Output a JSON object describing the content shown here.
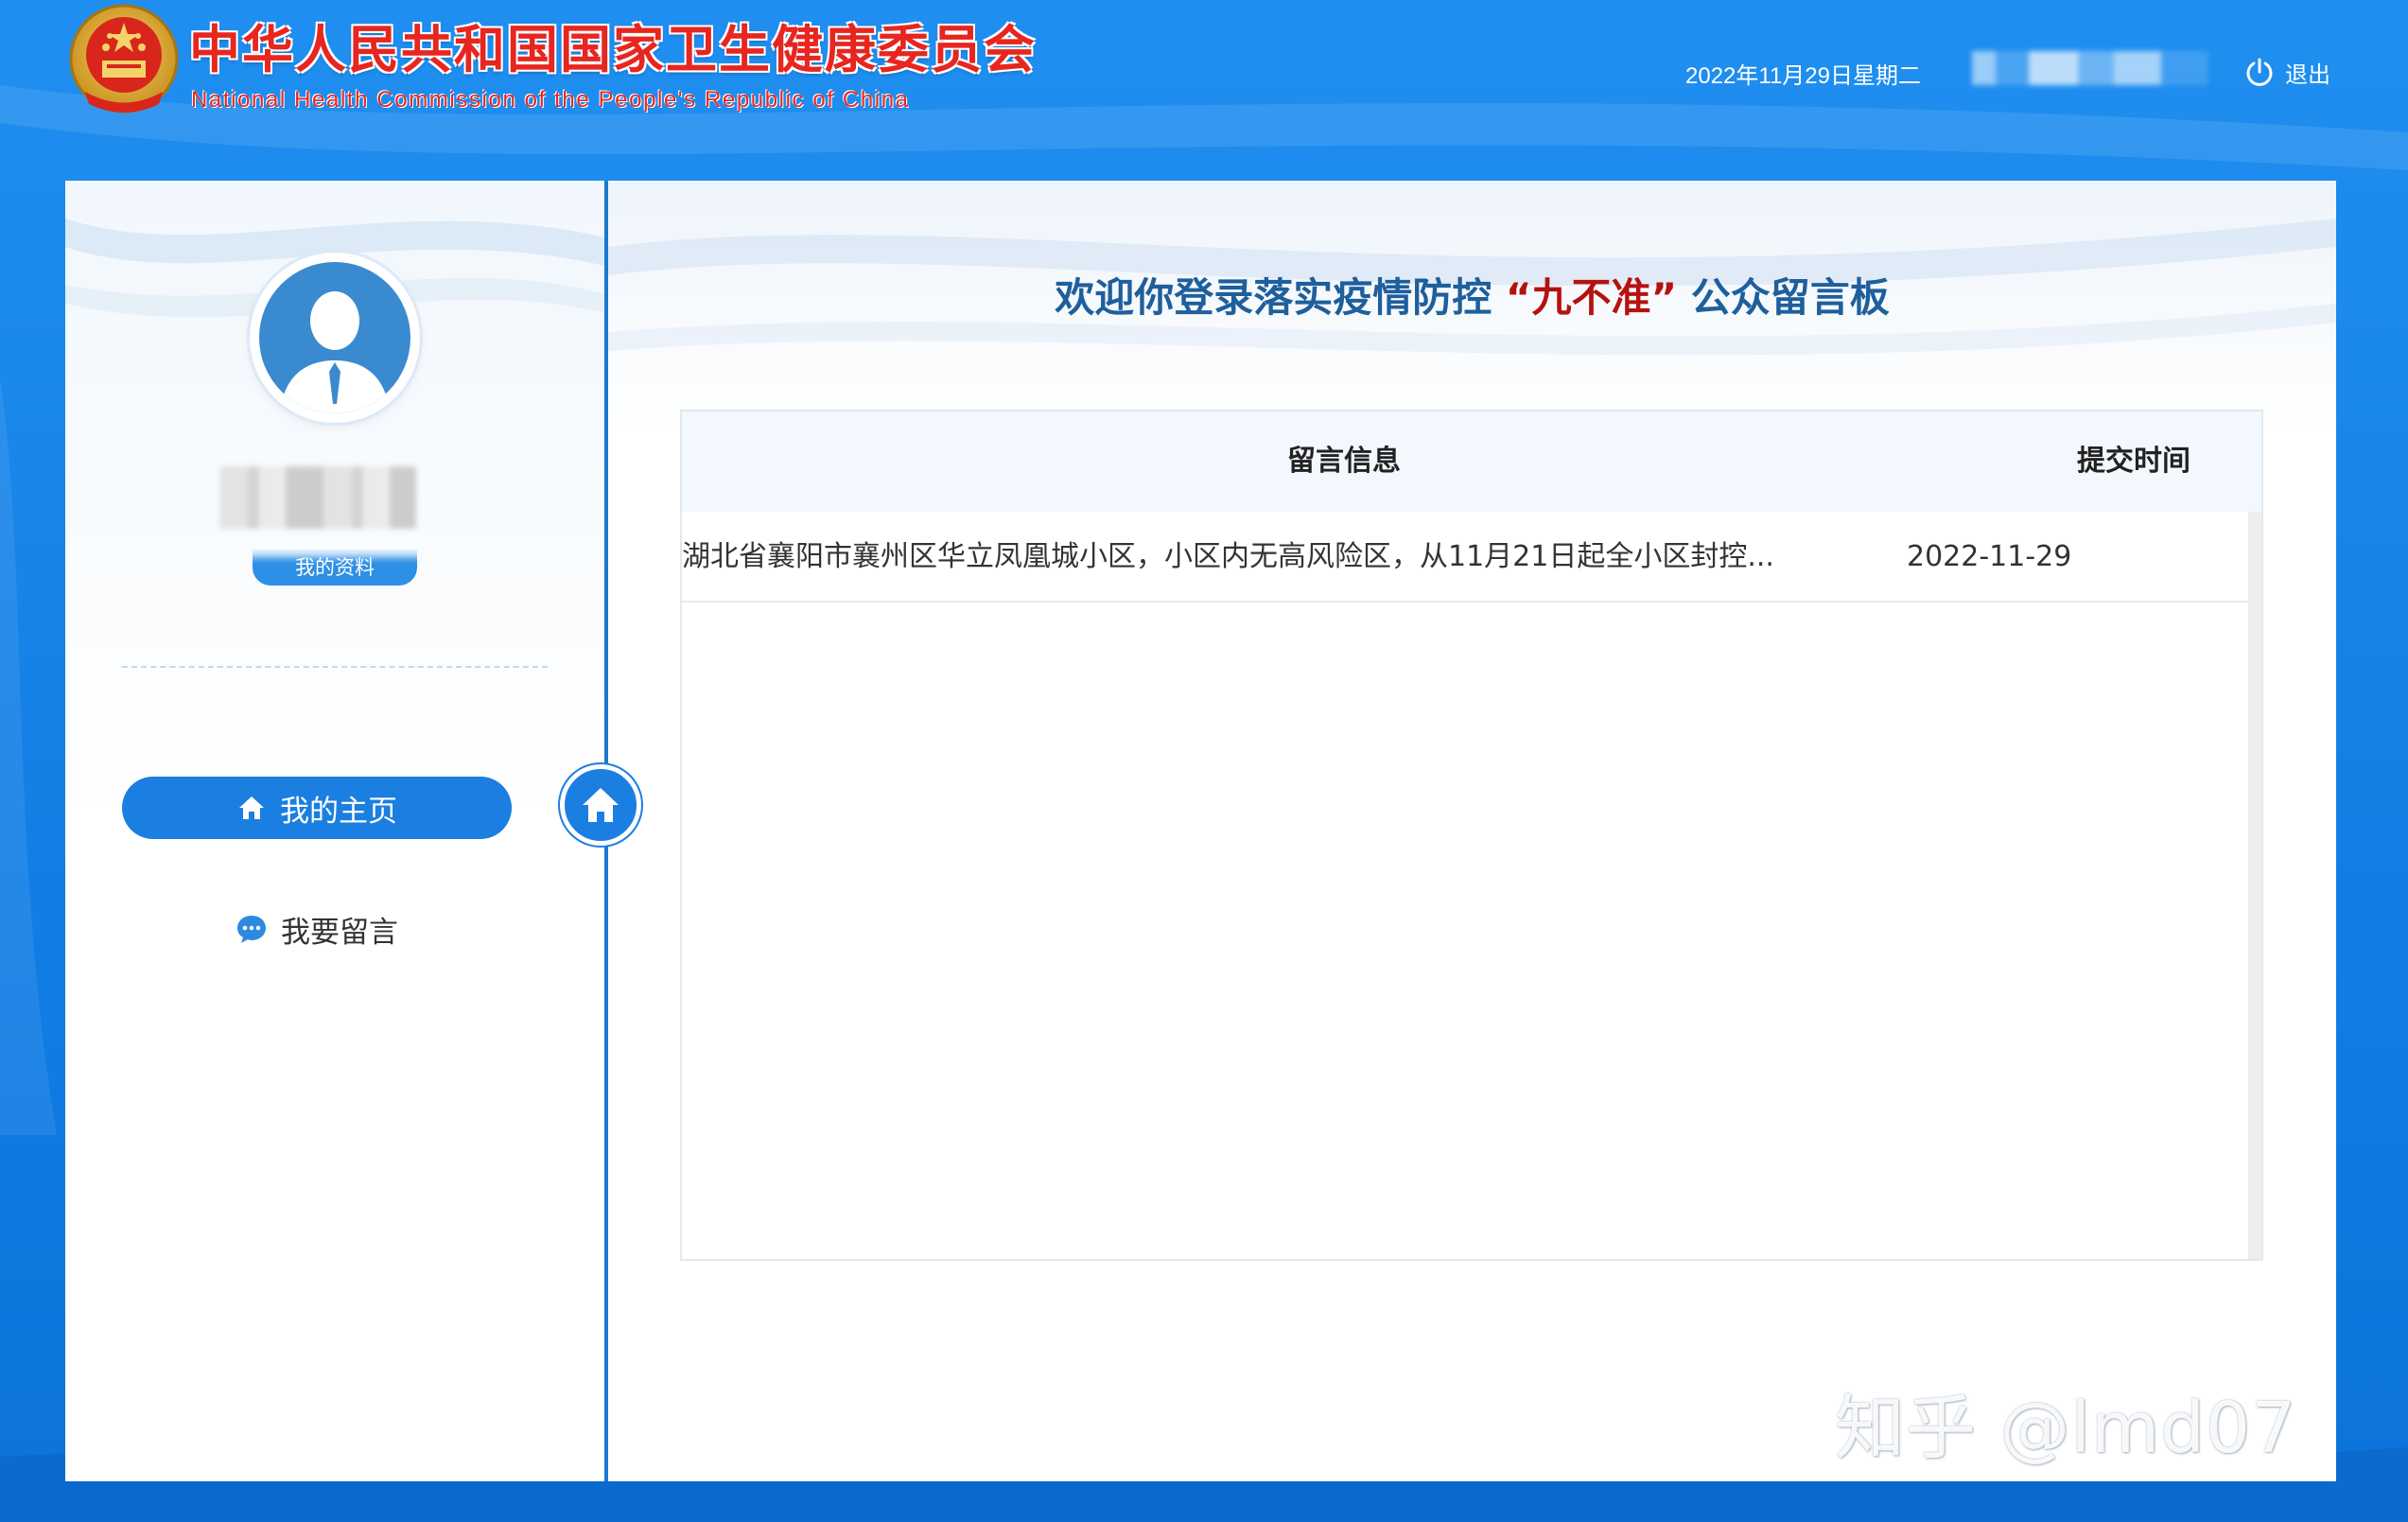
{
  "header": {
    "org_name_cn": "中华人民共和国国家卫生健康委员会",
    "org_name_en": "National Health Commission of the People's Republic of China",
    "date": "2022年11月29日星期二",
    "logout_label": "退出"
  },
  "sidebar": {
    "profile_button": "我的资料",
    "nav": {
      "home": "我的主页",
      "message": "我要留言"
    }
  },
  "main": {
    "title_prefix": "欢迎你登录落实疫情防控",
    "title_quote": "“九不准”",
    "title_suffix": "公众留言板",
    "table": {
      "columns": {
        "message": "留言信息",
        "time": "提交时间"
      },
      "rows": [
        {
          "message": "湖北省襄阳市襄州区华立凤凰城小区，小区内无高风险区，从11月21日起全小区封控...",
          "time": "2022-11-29"
        }
      ]
    }
  },
  "watermark": "知乎 @lmd07",
  "colors": {
    "background_blue": "#1a86ea",
    "accent_blue": "#1a7fe0",
    "title_blue": "#1e5f9c",
    "title_red": "#b5120f",
    "header_red": "#e6261f"
  },
  "icons": [
    "national-emblem-icon",
    "power-icon",
    "home-icon",
    "chat-bubble-icon",
    "user-avatar-icon"
  ]
}
